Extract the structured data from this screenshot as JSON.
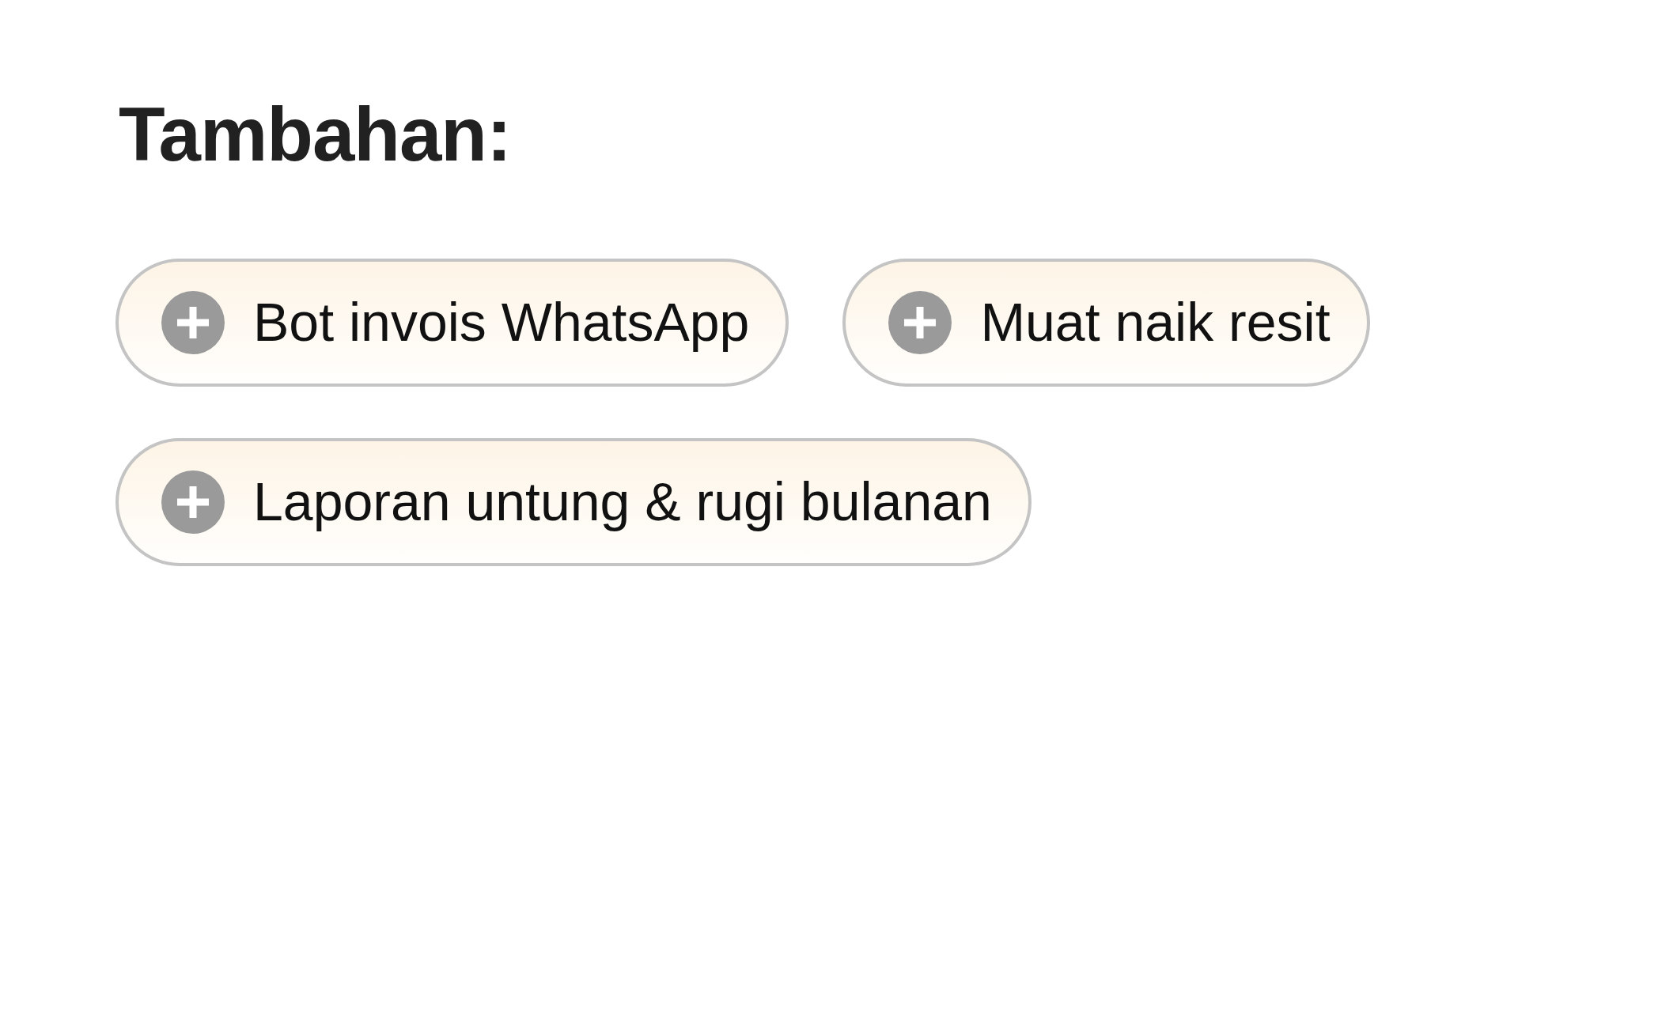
{
  "heading": "Tambahan:",
  "addons": [
    {
      "label": "Bot invois WhatsApp"
    },
    {
      "label": "Muat naik resit"
    },
    {
      "label": "Laporan untung & rugi bulanan"
    }
  ]
}
